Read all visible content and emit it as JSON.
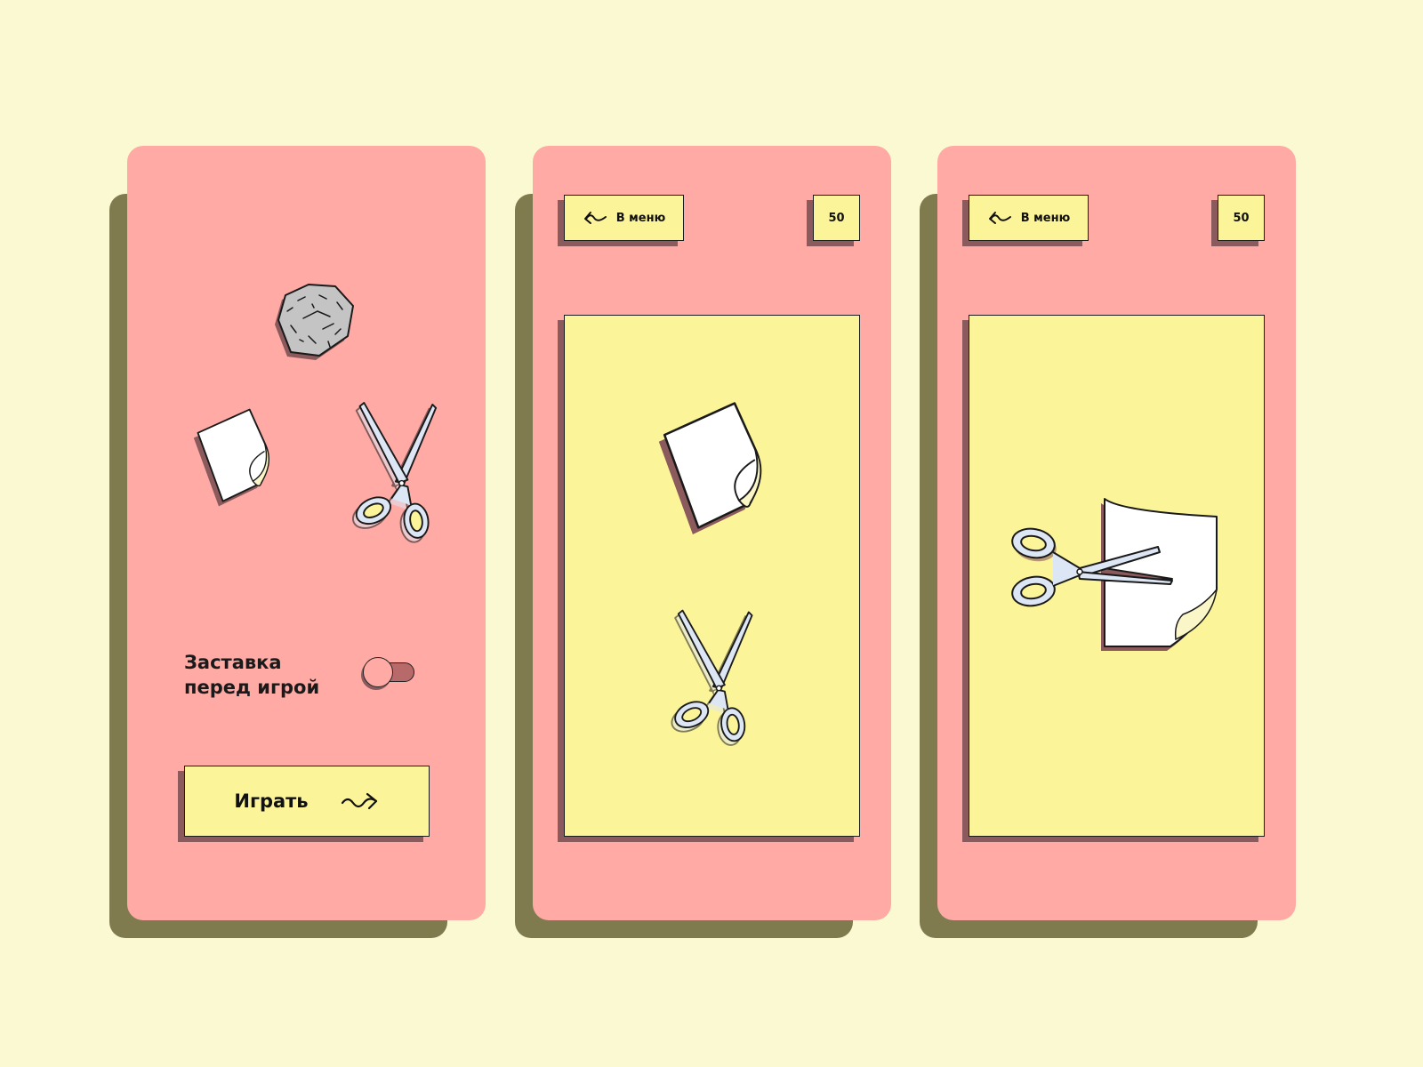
{
  "colors": {
    "background": "#fbf9d2",
    "card": "#ffaaa5",
    "card_shadow": "#7f7b4f",
    "panel": "#fcf498",
    "element_shadow": "#8a5a5c",
    "outline": "#1c1c1c"
  },
  "screens": [
    {
      "name": "menu",
      "icons": [
        "rock-icon",
        "paper-icon",
        "scissors-icon"
      ],
      "toggle": {
        "label": "Заставка перед игрой",
        "state": "off"
      },
      "play_button": {
        "label": "Играть",
        "icon": "squiggle-arrow-right-icon"
      }
    },
    {
      "name": "game-choice",
      "menu_button": {
        "label": "В меню",
        "icon": "squiggle-arrow-left-icon"
      },
      "score": "50",
      "board_icons": [
        "paper-icon",
        "scissors-icon"
      ]
    },
    {
      "name": "game-result",
      "menu_button": {
        "label": "В меню",
        "icon": "squiggle-arrow-left-icon"
      },
      "score": "50",
      "board_icons": [
        "scissors-cutting-paper-icon"
      ]
    }
  ]
}
